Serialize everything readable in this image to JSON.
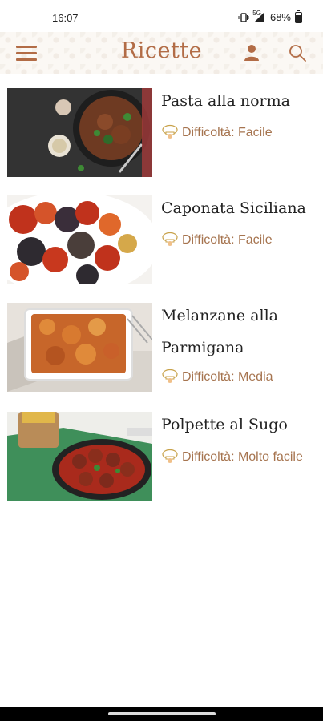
{
  "status_bar": {
    "time": "16:07",
    "network": "5G",
    "battery": "68%"
  },
  "header": {
    "title": "Ricette",
    "accent_color": "#b26c46"
  },
  "recipes": [
    {
      "title": "Pasta alla norma",
      "difficulty": "Difficoltà: Facile"
    },
    {
      "title": "Caponata Siciliana",
      "difficulty": "Difficoltà: Facile"
    },
    {
      "title": "Melanzane alla Parmigana",
      "difficulty": "Difficoltà: Media"
    },
    {
      "title": "Polpette al Sugo",
      "difficulty": "Difficoltà: Molto facile"
    }
  ],
  "icons": {
    "menu": "hamburger-menu-icon",
    "profile": "user-icon",
    "search": "search-icon",
    "difficulty": "chef-hat-icon"
  }
}
